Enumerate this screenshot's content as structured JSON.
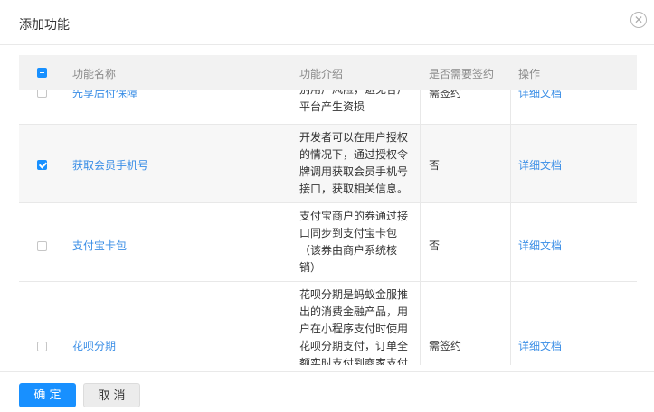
{
  "dialog": {
    "title": "添加功能",
    "close_icon": "close-icon"
  },
  "table": {
    "headers": {
      "name": "功能名称",
      "desc": "功能介绍",
      "sign": "是否需要签约",
      "action": "操作"
    },
    "rows": [
      {
        "checked": false,
        "name": "先享后付保障",
        "desc": "别用户风险，避免各户平台产生资损",
        "desc_lines": [
          "别用户风险，避免各户",
          "平台产生资损"
        ],
        "sign": "需签约",
        "action": "详细文档"
      },
      {
        "checked": true,
        "name": "获取会员手机号",
        "desc_lines": [
          "开发者可以在用户授权",
          "的情况下，通过授权令",
          "牌调用获取会员手机号",
          "接口，获取相关信息。"
        ],
        "sign": "否",
        "action": "详细文档"
      },
      {
        "checked": false,
        "name": "支付宝卡包",
        "desc_lines": [
          "支付宝商户的券通过接",
          "口同步到支付宝卡包",
          "（该券由商户系统核",
          "销）"
        ],
        "sign": "否",
        "action": "详细文档"
      },
      {
        "checked": false,
        "name": "花呗分期",
        "desc_lines": [
          "花呗分期是蚂蚁金服推",
          "出的消费金融产品，用",
          "户在小程序支付时使用",
          "花呗分期支付，订单全",
          "额实时支付到商家支付"
        ],
        "sign": "需签约",
        "action": "详细文档"
      }
    ]
  },
  "footer": {
    "confirm_label": "确 定",
    "cancel_label": "取 消"
  },
  "colors": {
    "primary": "#1890ff",
    "link": "#3a8ee6",
    "header_bg": "#f2f2f2"
  }
}
